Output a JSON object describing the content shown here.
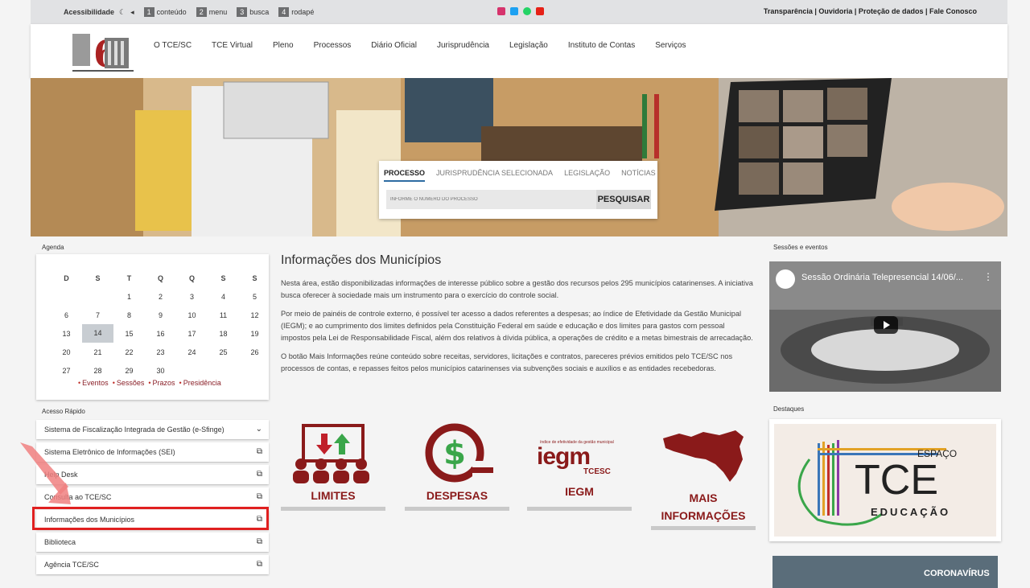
{
  "topbar": {
    "accessibility_label": "Acessibilidade",
    "shortcuts": [
      {
        "key": "1",
        "label": "conteúdo"
      },
      {
        "key": "2",
        "label": "menu"
      },
      {
        "key": "3",
        "label": "busca"
      },
      {
        "key": "4",
        "label": "rodapé"
      }
    ],
    "links": "Transparência | Ouvidoria | Proteção de dados | Fale Conosco"
  },
  "nav": [
    "O TCE/SC",
    "TCE Virtual",
    "Pleno",
    "Processos",
    "Diário Oficial",
    "Jurisprudência",
    "Legislação",
    "Instituto de Contas",
    "Serviços"
  ],
  "search": {
    "tabs": [
      "PROCESSO",
      "JURISPRUDÊNCIA SELECIONADA",
      "LEGISLAÇÃO",
      "NOTÍCIAS"
    ],
    "placeholder": "INFORME O NÚMERO DO PROCESSO",
    "button": "PESQUISAR"
  },
  "agenda": {
    "title": "Agenda",
    "weekdays": [
      "D",
      "S",
      "T",
      "Q",
      "Q",
      "S",
      "S"
    ],
    "weeks": [
      [
        "",
        "",
        "1",
        "2",
        "3",
        "4",
        "5"
      ],
      [
        "6",
        "7",
        "8",
        "9",
        "10",
        "11",
        "12"
      ],
      [
        "13",
        "14",
        "15",
        "16",
        "17",
        "18",
        "19"
      ],
      [
        "20",
        "21",
        "22",
        "23",
        "24",
        "25",
        "26"
      ],
      [
        "27",
        "28",
        "29",
        "30",
        "",
        "",
        ""
      ]
    ],
    "today": "14",
    "legend": [
      "Eventos",
      "Sessões",
      "Prazos",
      "Presidência"
    ]
  },
  "quick": {
    "title": "Acesso Rápido",
    "items": [
      "Sistema de Fiscalização Integrada de Gestão (e-Sfinge)",
      "Sistema Eletrônico de Informações (SEI)",
      "Help Desk",
      "Consulta ao TCE/SC",
      "Informações dos Municípios",
      "Biblioteca",
      "Agência TCE/SC"
    ]
  },
  "main": {
    "title": "Informações dos Municípios",
    "paragraphs": [
      "Nesta área, estão disponibilizadas informações de interesse público sobre a gestão dos recursos pelos 295 municípios catarinenses. A iniciativa busca oferecer à sociedade mais um instrumento para o exercício do controle social.",
      "Por meio de painéis de controle externo, é possível ter acesso a dados referentes a despesas; ao índice de Efetividade da Gestão Municipal (IEGM); e ao cumprimento dos limites definidos pela Constituição Federal em saúde e educação e dos limites para gastos com pessoal impostos pela Lei de Responsabilidade Fiscal, além dos relativos à dívida pública, a operações de crédito e a metas bimestrais de arrecadação.",
      "O botão Mais Informações reúne conteúdo sobre receitas, servidores, licitações e contratos, pareceres prévios emitidos pelo TCE/SC nos processos de contas, e repasses feitos pelos municípios catarinenses via subvenções sociais e auxílios e as entidades recebedoras."
    ],
    "cards": [
      "LIMITES",
      "DESPESAS",
      "IEGM",
      "MAIS INFORMAÇÕES"
    ],
    "iegm_sub": "TCESC",
    "iegm_top": "índice de efetividade da gestão municipal",
    "iegm_logo": "iegm"
  },
  "right": {
    "sessions_title": "Sessões e eventos",
    "video_title": "Sessão Ordinária Telepresencial 14/06/...",
    "highlights_title": "Destaques",
    "espaco": "ESPAÇO",
    "tce": "TCE",
    "educacao": "EDUCAÇÃO",
    "corona": "CORONAVÍRUS"
  },
  "colors": {
    "brand_red": "#8a1a1a",
    "highlight_red": "#e02020"
  }
}
